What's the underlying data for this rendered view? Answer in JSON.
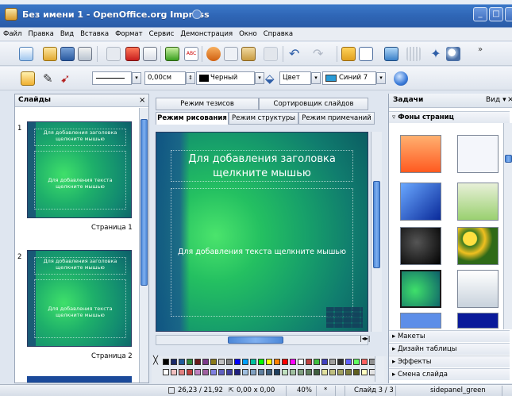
{
  "window": {
    "title": "Без имени 1 - OpenOffice.org Impress",
    "minimize": "_",
    "maximize": "□"
  },
  "menu": [
    "Файл",
    "Правка",
    "Вид",
    "Вставка",
    "Формат",
    "Сервис",
    "Демонстрация",
    "Окно",
    "Справка"
  ],
  "toolbar2": {
    "line_width": "0,00см",
    "line_color": "Черный",
    "area_style": "Цвет",
    "area_color": "Синий 7"
  },
  "slides_panel": {
    "title": "Слайды",
    "close": "×",
    "slides": [
      {
        "number": "1",
        "title_placeholder": "Для добавления заголовка щелкните мышью",
        "text_placeholder": "Для добавления текста щелкните мышью",
        "label": "Страница 1"
      },
      {
        "number": "2",
        "title_placeholder": "Для добавления заголовка щелкните мышью",
        "text_placeholder": "Для добавления текста щелкните мышью",
        "label": "Страница 2"
      }
    ]
  },
  "view_tabs": {
    "row1": [
      "Режим тезисов",
      "Сортировщик слайдов"
    ],
    "row2": [
      "Режим рисования",
      "Режим структуры",
      "Режим примечаний"
    ],
    "active": "Режим рисования"
  },
  "slide": {
    "title_placeholder": "Для добавления заголовка щелкните мышью",
    "text_placeholder": "Для добавления текста щелкните мышью"
  },
  "tasks": {
    "title": "Задачи",
    "view_menu": "Вид ▾",
    "close": "×",
    "section_open": "Фоны страниц",
    "sections": [
      "Макеты",
      "Дизайн таблицы",
      "Эффекты",
      "Смена слайда"
    ]
  },
  "statusbar": {
    "position": "26,23 / 21,92",
    "size": "0,00 x 0,00",
    "zoom": "40%",
    "slide": "Слайд 3 / 3",
    "design": "sidepanel_green"
  },
  "colors": {
    "title_bar": "#2f66b6",
    "slide_green": "#24c061",
    "slide_blue": "#0f4a86"
  }
}
